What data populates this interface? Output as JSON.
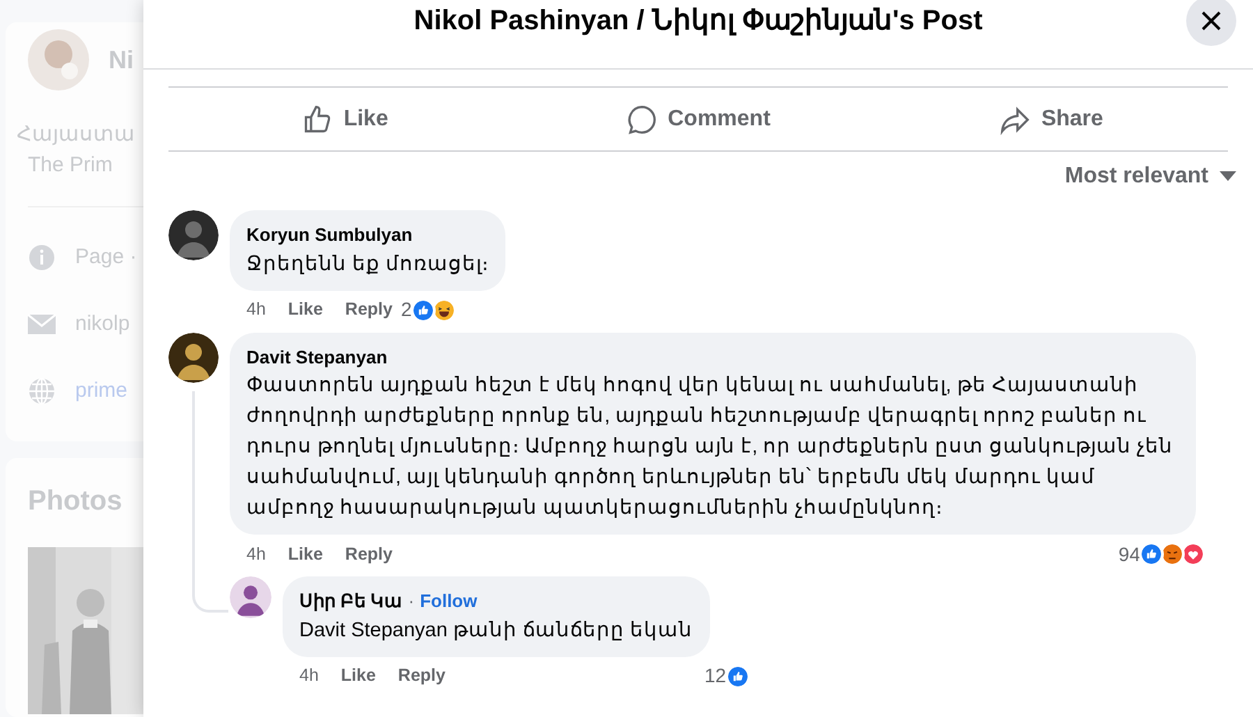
{
  "background_page": {
    "name": "Ni",
    "bio_lines": [
      "Հայաստա",
      "The Prim"
    ],
    "info_items": [
      {
        "kind": "info",
        "text": "Page ·"
      },
      {
        "kind": "mail",
        "text": "nikolp"
      },
      {
        "kind": "web",
        "text": "prime"
      }
    ],
    "photos_heading": "Photos"
  },
  "post_dialog": {
    "title": "Nikol Pashinyan / Նիկոլ Փաշինյան's Post",
    "actions": [
      {
        "kind": "like",
        "label": "Like"
      },
      {
        "kind": "comment",
        "label": "Comment"
      },
      {
        "kind": "share",
        "label": "Share"
      }
    ],
    "sort": "Most relevant",
    "comments": [
      {
        "author": "Koryun Sumbulyan",
        "text": "Ջրեղենն եք մոռացել։",
        "time": "4h",
        "actions": [
          "Like",
          "Reply"
        ],
        "reaction_count": "2",
        "reactions": [
          {
            "kind": "like"
          },
          {
            "kind": "haha"
          }
        ]
      },
      {
        "author": "Davit Stepanyan",
        "text": "Փաստորեն այդքան հեշտ է մեկ հոգով վեր կենալ ու սահմանել, թե Հայաստանի ժողովրդի արժեքները որոնք են, այդքան հեշտությամբ վերագրել որոշ բաներ ու դուրս թողնել մյուսները։ Ամբողջ հարցն այն է, որ արժեքներն ըստ ցանկության չեն սահմանվում, այլ կենդանի գործող երևույթներ են՝ երբեմն մեկ մարդու կամ ամբողջ հասարակության պատկերացումներին չհամընկնող։",
        "time": "4h",
        "actions": [
          "Like",
          "Reply"
        ],
        "reaction_count": "94",
        "reactions": [
          {
            "kind": "like"
          },
          {
            "kind": "angry"
          },
          {
            "kind": "love"
          }
        ],
        "replies": [
          {
            "author": "Սիր Բե Կա",
            "separator": "·",
            "follow": "Follow",
            "text": "Davit Stepanyan թանի ճանճերը եկան",
            "time": "4h",
            "actions": [
              "Like",
              "Reply"
            ],
            "reaction_count": "12",
            "reactions": [
              {
                "kind": "like"
              }
            ]
          }
        ]
      }
    ]
  }
}
